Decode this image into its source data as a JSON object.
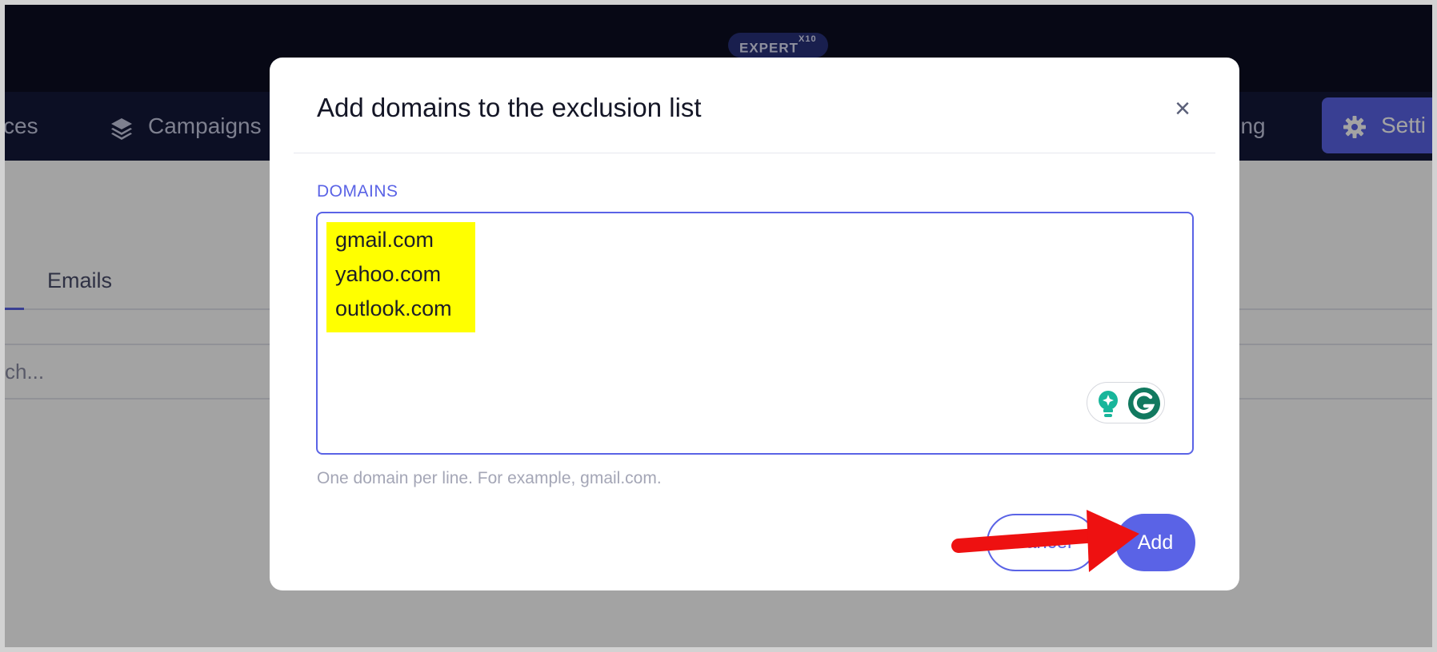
{
  "header": {
    "plan_badge": "EXPERT",
    "plan_badge_sup": "X10"
  },
  "nav": {
    "items": [
      {
        "label": "ces",
        "icon": "none"
      },
      {
        "label": "Campaigns",
        "icon": "layers-icon"
      },
      {
        "label": "ling",
        "icon": "none"
      }
    ],
    "active": {
      "label": "Setti",
      "icon": "gear-icon"
    }
  },
  "page": {
    "tab_emails": "Emails",
    "search_placeholder": "ch..."
  },
  "modal": {
    "title": "Add domains to the exclusion list",
    "close_symbol": "×",
    "field_label": "DOMAINS",
    "domains": [
      "gmail.com",
      "yahoo.com",
      "outlook.com"
    ],
    "helper_text": "One domain per line. For example, gmail.com.",
    "cancel_label": "Cancel",
    "add_label": "Add"
  },
  "colors": {
    "accent": "#5a63e6",
    "topbar": "#0b0d21",
    "highlight": "#ffff00",
    "annotation_arrow": "#ee1111"
  }
}
